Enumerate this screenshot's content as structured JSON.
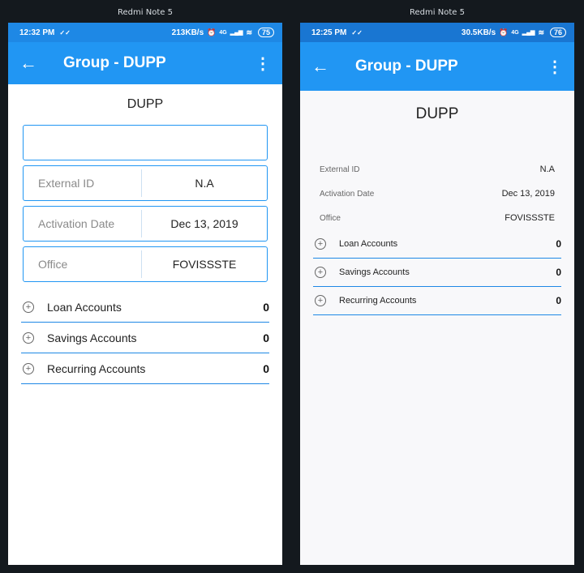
{
  "device_name": "Redmi Note 5",
  "left": {
    "status": {
      "time": "12:32 PM",
      "speed": "213KB/s",
      "battery": "75"
    },
    "appbar": {
      "title": "Group - DUPP",
      "back_icon": "←",
      "menu_icon": "⋮"
    },
    "group_name": "DUPP",
    "empty_field_value": "",
    "fields": [
      {
        "label": "External ID",
        "value": "N.A"
      },
      {
        "label": "Activation Date",
        "value": "Dec 13, 2019"
      },
      {
        "label": "Office",
        "value": "FOVISSSTE"
      }
    ],
    "accounts": [
      {
        "label": "Loan Accounts",
        "count": "0"
      },
      {
        "label": "Savings Accounts",
        "count": "0"
      },
      {
        "label": "Recurring Accounts",
        "count": "0"
      }
    ]
  },
  "right": {
    "status": {
      "time": "12:25 PM",
      "speed": "30.5KB/s",
      "battery": "76"
    },
    "appbar": {
      "title": "Group - DUPP",
      "back_icon": "←",
      "menu_icon": "⋮"
    },
    "group_name": "DUPP",
    "details": [
      {
        "label": "External ID",
        "value": "N.A"
      },
      {
        "label": "Activation Date",
        "value": "Dec 13, 2019"
      },
      {
        "label": "Office",
        "value": "FOVISSSTE"
      }
    ],
    "accounts": [
      {
        "label": "Loan Accounts",
        "count": "0"
      },
      {
        "label": "Savings Accounts",
        "count": "0"
      },
      {
        "label": "Recurring Accounts",
        "count": "0"
      }
    ]
  },
  "status_icons": {
    "check": "✓✓",
    "alarm_off": "⏰",
    "signal": "▂▄▆",
    "wifi": "≋",
    "network": "4G"
  }
}
